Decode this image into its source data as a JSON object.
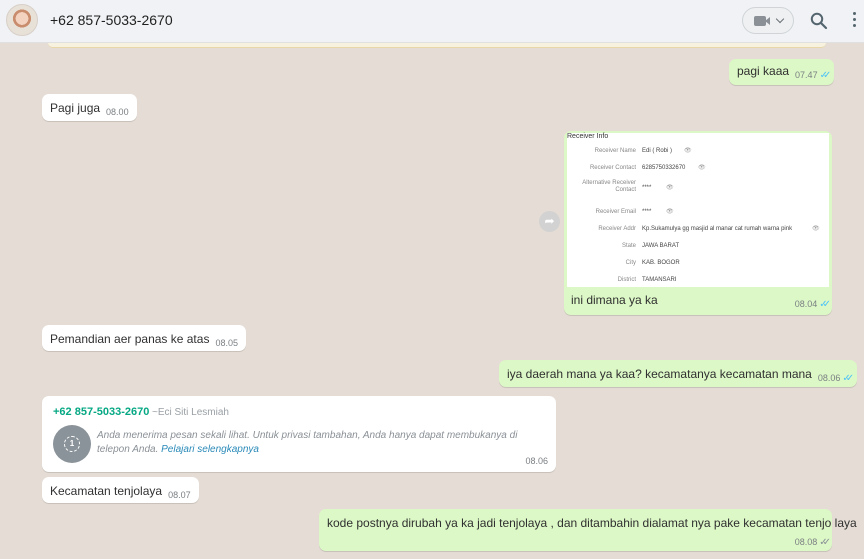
{
  "header": {
    "contact_name": "+62 857-5033-2670"
  },
  "icons": {
    "avatar": "contact-avatar",
    "video": "video-camera-icon",
    "search": "search-icon",
    "menu": "more-vertical-icon",
    "forward": "forward-arrow-icon",
    "view_once": "view-once-icon",
    "eye": "eye-icon"
  },
  "colors": {
    "incoming_bubble": "#ffffff",
    "outgoing_bubble": "#dcf8c6",
    "chat_background": "#e5ddd5",
    "read_ticks": "#4fc3f7",
    "sender_name": "#06a884"
  },
  "messages": [
    {
      "direction": "out",
      "text": "pagi kaaa",
      "time": "07.47",
      "status": "read"
    },
    {
      "direction": "in",
      "text": "Pagi juga",
      "time": "08.00"
    },
    {
      "direction": "out",
      "type": "image",
      "caption": "ini dimana ya ka",
      "time": "08.04",
      "status": "read"
    },
    {
      "direction": "in",
      "text": "Pemandian aer panas ke atas",
      "time": "08.05"
    },
    {
      "direction": "out",
      "text": "iya daerah mana ya kaa? kecamatanya kecamatan mana",
      "time": "08.06",
      "status": "read"
    },
    {
      "direction": "in",
      "type": "view_once",
      "sender_phone": "+62 857-5033-2670",
      "sender_alias": "~Eci Siti Lesmiah",
      "text": "Anda menerima pesan sekali lihat. Untuk privasi tambahan, Anda hanya dapat membukanya di telepon Anda.",
      "link": "Pelajari selengkapnya",
      "time": "08.06"
    },
    {
      "direction": "in",
      "text": "Kecamatan tenjolaya",
      "time": "08.07"
    },
    {
      "direction": "out",
      "text": "kode postnya dirubah ya ka jadi tenjolaya , dan ditambahin dialamat nya pake kecamatan tenjo laya",
      "time": "08.08",
      "status": "sent"
    }
  ],
  "receiver_card": {
    "title": "Receiver Info",
    "rows": [
      {
        "label": "Receiver Name",
        "value": "Edi ( Robi )",
        "masked_icon": true
      },
      {
        "label": "Receiver Contact",
        "value": "6285750332670",
        "masked_icon": true
      },
      {
        "label": "Alternative Receiver Contact",
        "value": "****",
        "masked_icon": true
      },
      {
        "label": "Receiver Email",
        "value": "****",
        "masked_icon": true
      },
      {
        "label": "Receiver Addr",
        "value": "Kp.Sukamulya gg masjid al manar cat rumah warna pink",
        "masked_icon": true
      },
      {
        "label": "State",
        "value": "JAWA BARAT",
        "masked_icon": false
      },
      {
        "label": "City",
        "value": "KAB. BOGOR",
        "masked_icon": false
      },
      {
        "label": "District",
        "value": "TAMANSARI",
        "masked_icon": false
      }
    ]
  }
}
